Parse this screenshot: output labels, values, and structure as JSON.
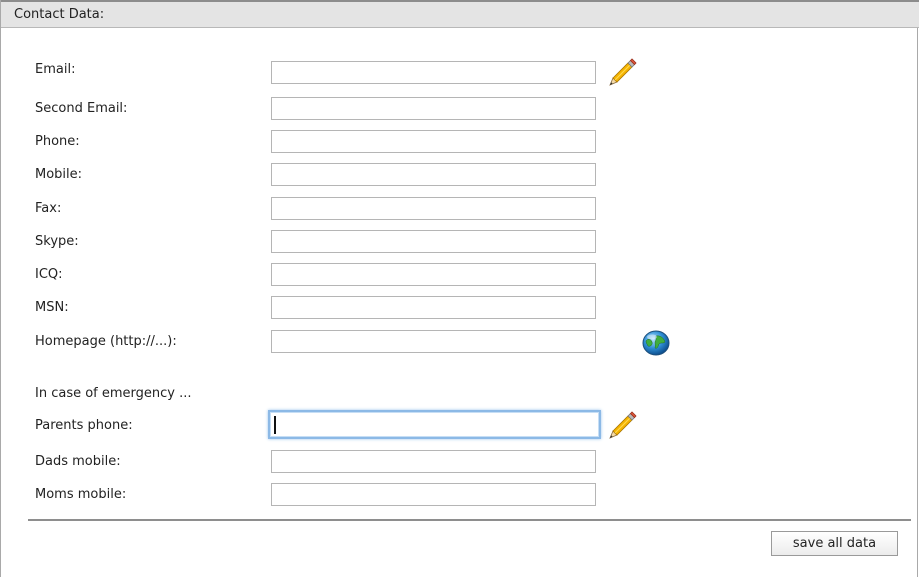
{
  "header": {
    "title": "Contact Data:"
  },
  "fields": [
    {
      "key": "email",
      "label": "Email:",
      "value": "",
      "action_icon": "pencil-icon"
    },
    {
      "key": "second_email",
      "label": "Second Email:",
      "value": ""
    },
    {
      "key": "phone",
      "label": "Phone:",
      "value": ""
    },
    {
      "key": "mobile",
      "label": "Mobile:",
      "value": ""
    },
    {
      "key": "fax",
      "label": "Fax:",
      "value": ""
    },
    {
      "key": "skype",
      "label": "Skype:",
      "value": ""
    },
    {
      "key": "icq",
      "label": "ICQ:",
      "value": ""
    },
    {
      "key": "msn",
      "label": "MSN:",
      "value": ""
    },
    {
      "key": "homepage",
      "label": "Homepage (http://...):",
      "value": "",
      "action_icon": "globe-icon"
    }
  ],
  "emergency": {
    "section_label": "In case of emergency ...",
    "fields": [
      {
        "key": "parents_phone",
        "label": "Parents phone:",
        "value": "",
        "focused": true,
        "action_icon": "pencil-icon"
      },
      {
        "key": "dads_mobile",
        "label": "Dads mobile:",
        "value": ""
      },
      {
        "key": "moms_mobile",
        "label": "Moms mobile:",
        "value": ""
      }
    ]
  },
  "footer": {
    "save_label": "save all data"
  },
  "colors": {
    "header_bg": "#e4e4e4",
    "focus_ring": "#8cb9e6",
    "divider": "#8e8e8e"
  }
}
